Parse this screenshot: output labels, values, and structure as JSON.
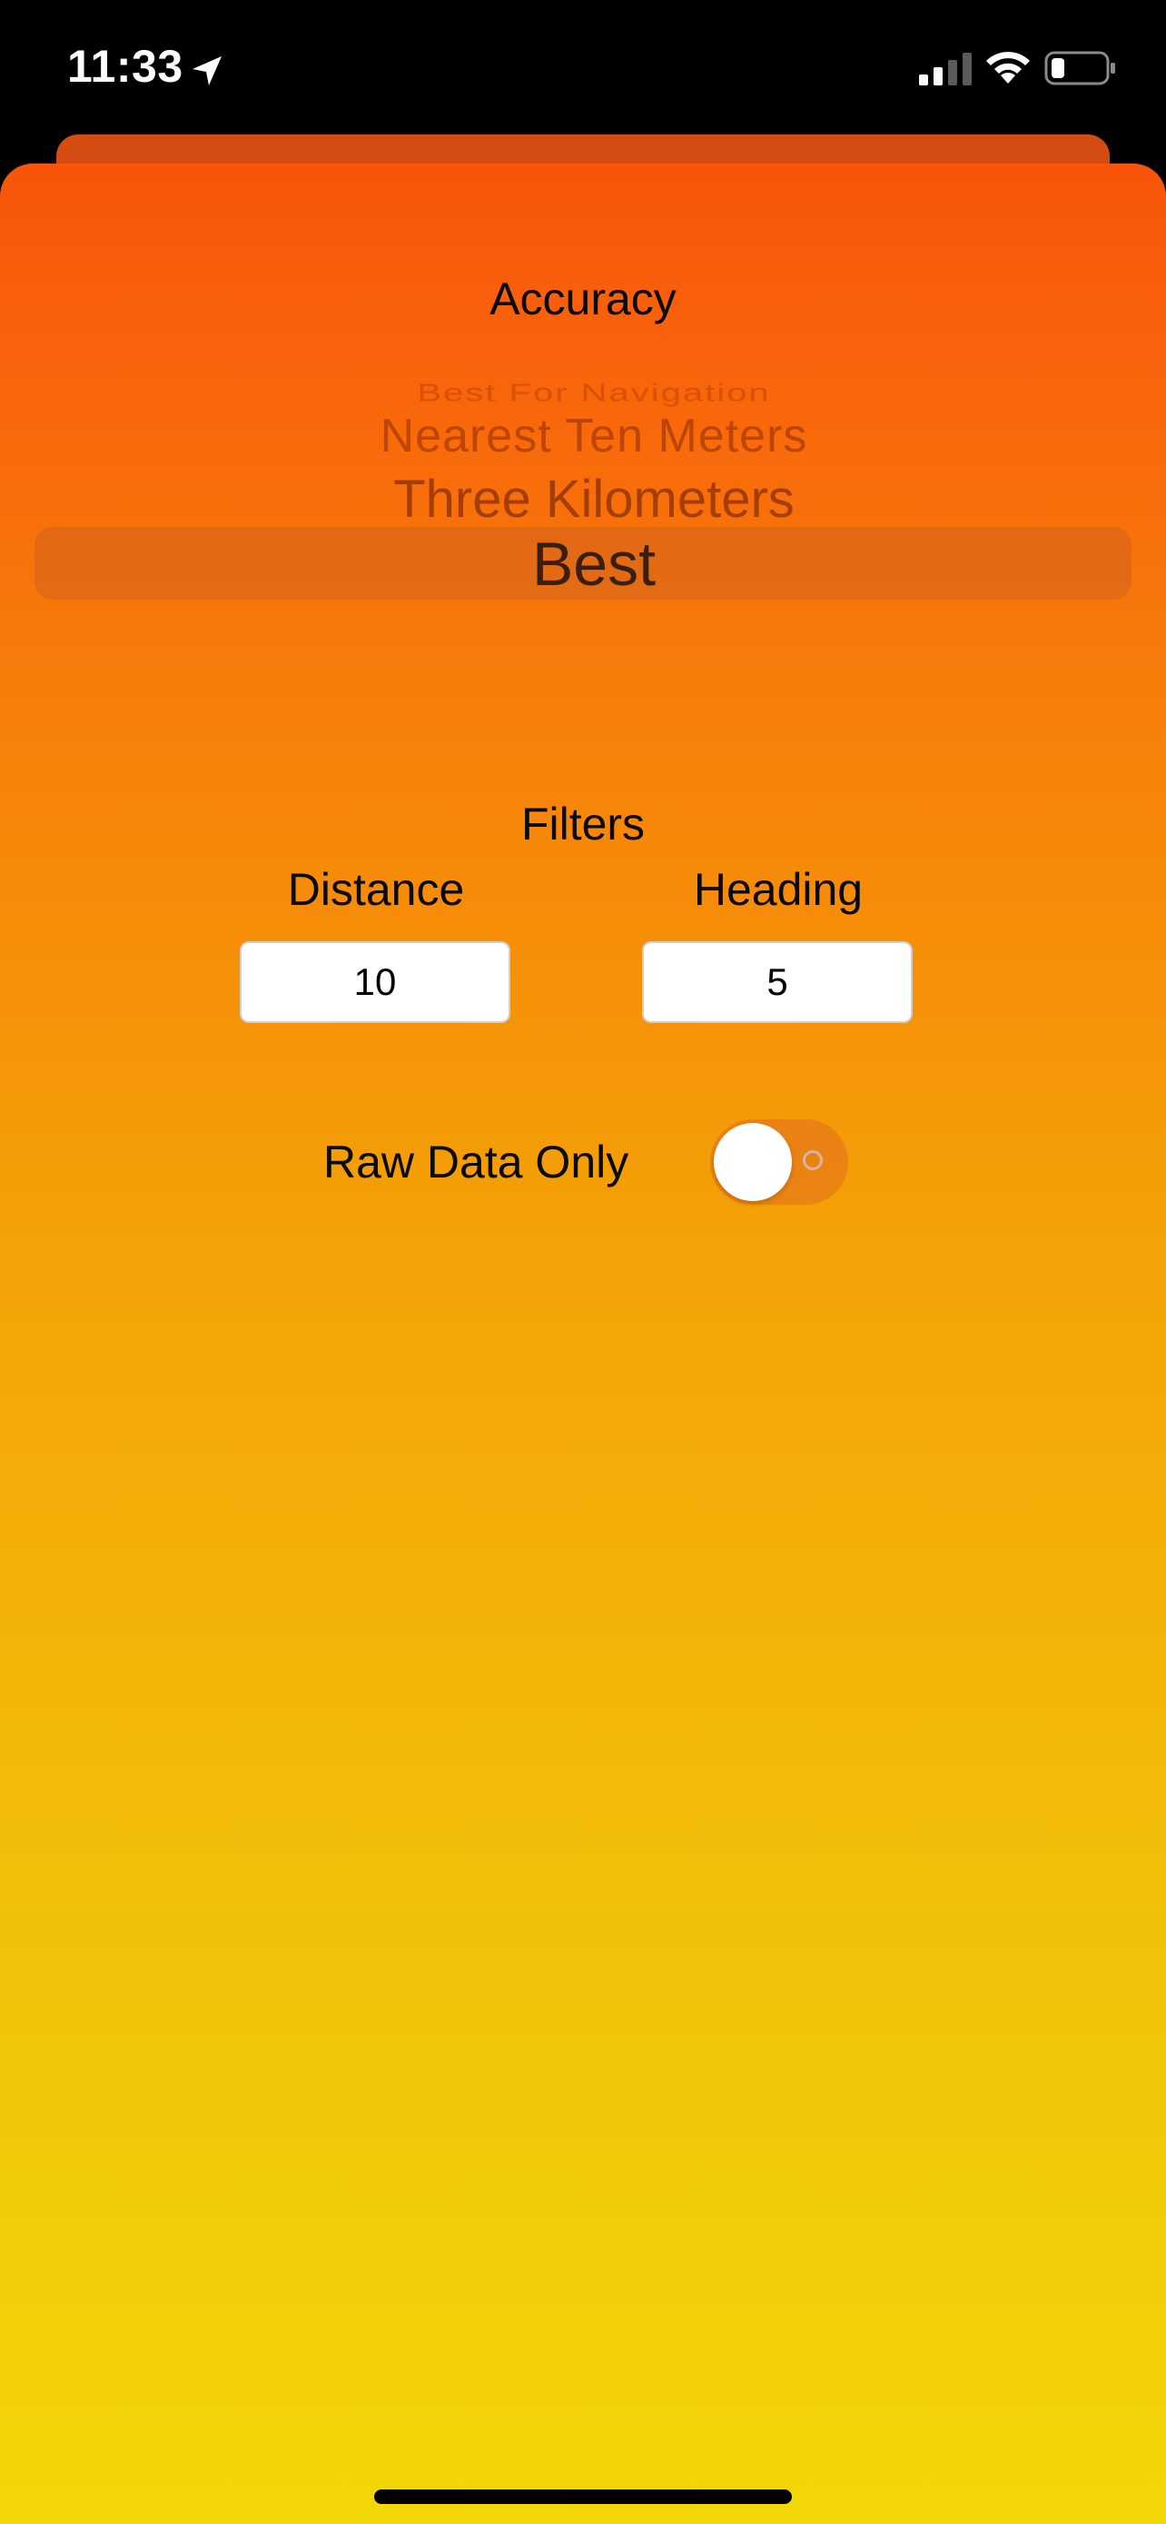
{
  "status_bar": {
    "time": "11:33",
    "location_icon": "location-arrow-icon",
    "signal_icon": "cellular-signal-icon",
    "wifi_icon": "wifi-icon",
    "battery_icon": "battery-low-icon"
  },
  "accuracy": {
    "title": "Accuracy",
    "picker_items": [
      "Best For Navigation",
      "Nearest Ten Meters",
      "Three Kilometers",
      "Best"
    ],
    "selected": "Best"
  },
  "filters": {
    "title": "Filters",
    "distance_label": "Distance",
    "distance_value": "10",
    "heading_label": "Heading",
    "heading_value": "5"
  },
  "raw_data": {
    "label": "Raw Data Only",
    "enabled": false
  },
  "colors": {
    "gradient_top": "#f8540b",
    "gradient_bottom": "#f2d706",
    "text": "#0a0a0a"
  }
}
